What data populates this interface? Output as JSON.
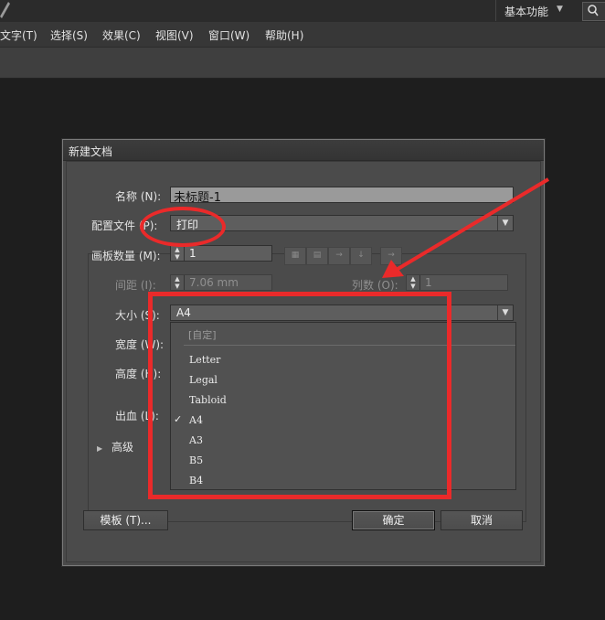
{
  "header": {
    "workspace_label": "基本功能",
    "menu": [
      "文字(T)",
      "选择(S)",
      "效果(C)",
      "视图(V)",
      "窗口(W)",
      "帮助(H)"
    ]
  },
  "dialog": {
    "title": "新建文档",
    "name_label": "名称 (N):",
    "name_value": "未标题-1",
    "profile_label": "配置文件 (P):",
    "profile_value": "打印",
    "artboards_label": "画板数量 (M):",
    "artboards_value": "1",
    "spacing_label": "间距 (I):",
    "spacing_value": "7.06 mm",
    "columns_label": "列数 (O):",
    "columns_value": "1",
    "size_label": "大小 (S):",
    "size_value": "A4",
    "width_label": "宽度 (W):",
    "height_label": "高度 (H):",
    "bleed_label": "出血 (L):",
    "advanced_label": "高级",
    "template_button": "模板 (T)...",
    "ok_button": "确定",
    "cancel_button": "取消"
  },
  "size_dropdown": {
    "header": "[自定]",
    "options": [
      "Letter",
      "Legal",
      "Tabloid",
      "A4",
      "A3",
      "B5",
      "B4"
    ],
    "selected": "A4"
  },
  "icons": [
    "app-feather-icon",
    "search-icon",
    "dropdown-arrow-icon",
    "checkmark-icon",
    "disclosure-triangle-icon"
  ],
  "colors": {
    "annotation": "#ea2a2a",
    "panel": "#4a4a4a",
    "background": "#1e1e1e"
  }
}
